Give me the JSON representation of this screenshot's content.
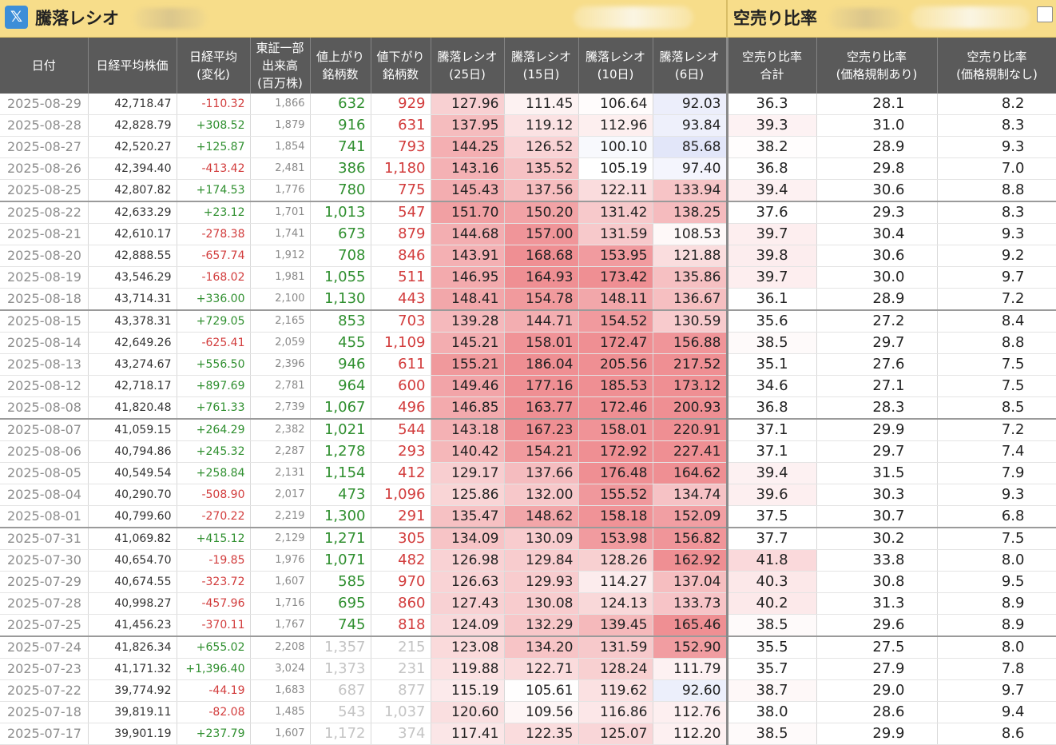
{
  "header": {
    "app_icon": "x-logo-icon",
    "app_icon_glyph": "𝕏",
    "left_title": "騰落レシオ",
    "right_title": "空売り比率"
  },
  "columns": [
    "日付",
    "日経平均株価",
    "日経平均\n(変化)",
    "東証一部\n出来高\n(百万株)",
    "値上がり\n銘柄数",
    "値下がり\n銘柄数",
    "騰落レシオ\n(25日)",
    "騰落レシオ\n(15日)",
    "騰落レシオ\n(10日)",
    "騰落レシオ\n(6日)",
    "空売り比率\n合計",
    "空売り比率\n(価格規制あり)",
    "空売り比率\n(価格規制なし)"
  ],
  "colors": {
    "header_bg": "#5a5a5a",
    "title_bar": "#f7dd8a",
    "positive": "#2f8f2f",
    "negative": "#d23c3c",
    "heat_high": "#ef8f93",
    "heat_low": "#e3e6f7"
  },
  "rows": [
    {
      "date": "2025-08-29",
      "nikkei": "42,718.47",
      "change": "-110.32",
      "volume": "1,866",
      "adv": "632",
      "dec": "929",
      "r25": "127.96",
      "r15": "111.45",
      "r10": "106.64",
      "r6": "92.03",
      "sr_total": "36.3",
      "sr_reg": "28.1",
      "sr_noreg": "8.2"
    },
    {
      "date": "2025-08-28",
      "nikkei": "42,828.79",
      "change": "+308.52",
      "volume": "1,879",
      "adv": "916",
      "dec": "631",
      "r25": "137.95",
      "r15": "119.12",
      "r10": "112.96",
      "r6": "93.84",
      "sr_total": "39.3",
      "sr_reg": "31.0",
      "sr_noreg": "8.3"
    },
    {
      "date": "2025-08-27",
      "nikkei": "42,520.27",
      "change": "+125.87",
      "volume": "1,854",
      "adv": "741",
      "dec": "793",
      "r25": "144.25",
      "r15": "126.52",
      "r10": "100.10",
      "r6": "85.68",
      "sr_total": "38.2",
      "sr_reg": "28.9",
      "sr_noreg": "9.3"
    },
    {
      "date": "2025-08-26",
      "nikkei": "42,394.40",
      "change": "-413.42",
      "volume": "2,481",
      "adv": "386",
      "dec": "1,180",
      "r25": "143.16",
      "r15": "135.52",
      "r10": "105.19",
      "r6": "97.40",
      "sr_total": "36.8",
      "sr_reg": "29.8",
      "sr_noreg": "7.0"
    },
    {
      "date": "2025-08-25",
      "nikkei": "42,807.82",
      "change": "+174.53",
      "volume": "1,776",
      "adv": "780",
      "dec": "775",
      "r25": "145.43",
      "r15": "137.56",
      "r10": "122.11",
      "r6": "133.94",
      "sr_total": "39.4",
      "sr_reg": "30.6",
      "sr_noreg": "8.8"
    },
    {
      "date": "2025-08-22",
      "nikkei": "42,633.29",
      "change": "+23.12",
      "volume": "1,701",
      "adv": "1,013",
      "dec": "547",
      "r25": "151.70",
      "r15": "150.20",
      "r10": "131.42",
      "r6": "138.25",
      "sr_total": "37.6",
      "sr_reg": "29.3",
      "sr_noreg": "8.3",
      "wk": true
    },
    {
      "date": "2025-08-21",
      "nikkei": "42,610.17",
      "change": "-278.38",
      "volume": "1,741",
      "adv": "673",
      "dec": "879",
      "r25": "144.68",
      "r15": "157.00",
      "r10": "131.59",
      "r6": "108.53",
      "sr_total": "39.7",
      "sr_reg": "30.4",
      "sr_noreg": "9.3"
    },
    {
      "date": "2025-08-20",
      "nikkei": "42,888.55",
      "change": "-657.74",
      "volume": "1,912",
      "adv": "708",
      "dec": "846",
      "r25": "143.91",
      "r15": "168.68",
      "r10": "153.95",
      "r6": "121.88",
      "sr_total": "39.8",
      "sr_reg": "30.6",
      "sr_noreg": "9.2"
    },
    {
      "date": "2025-08-19",
      "nikkei": "43,546.29",
      "change": "-168.02",
      "volume": "1,981",
      "adv": "1,055",
      "dec": "511",
      "r25": "146.95",
      "r15": "164.93",
      "r10": "173.42",
      "r6": "135.86",
      "sr_total": "39.7",
      "sr_reg": "30.0",
      "sr_noreg": "9.7"
    },
    {
      "date": "2025-08-18",
      "nikkei": "43,714.31",
      "change": "+336.00",
      "volume": "2,100",
      "adv": "1,130",
      "dec": "443",
      "r25": "148.41",
      "r15": "154.78",
      "r10": "148.11",
      "r6": "136.67",
      "sr_total": "36.1",
      "sr_reg": "28.9",
      "sr_noreg": "7.2"
    },
    {
      "date": "2025-08-15",
      "nikkei": "43,378.31",
      "change": "+729.05",
      "volume": "2,165",
      "adv": "853",
      "dec": "703",
      "r25": "139.28",
      "r15": "144.71",
      "r10": "154.52",
      "r6": "130.59",
      "sr_total": "35.6",
      "sr_reg": "27.2",
      "sr_noreg": "8.4",
      "wk": true
    },
    {
      "date": "2025-08-14",
      "nikkei": "42,649.26",
      "change": "-625.41",
      "volume": "2,059",
      "adv": "455",
      "dec": "1,109",
      "r25": "145.21",
      "r15": "158.01",
      "r10": "172.47",
      "r6": "156.88",
      "sr_total": "38.5",
      "sr_reg": "29.7",
      "sr_noreg": "8.8"
    },
    {
      "date": "2025-08-13",
      "nikkei": "43,274.67",
      "change": "+556.50",
      "volume": "2,396",
      "adv": "946",
      "dec": "611",
      "r25": "155.21",
      "r15": "186.04",
      "r10": "205.56",
      "r6": "217.52",
      "sr_total": "35.1",
      "sr_reg": "27.6",
      "sr_noreg": "7.5"
    },
    {
      "date": "2025-08-12",
      "nikkei": "42,718.17",
      "change": "+897.69",
      "volume": "2,781",
      "adv": "964",
      "dec": "600",
      "r25": "149.46",
      "r15": "177.16",
      "r10": "185.53",
      "r6": "173.12",
      "sr_total": "34.6",
      "sr_reg": "27.1",
      "sr_noreg": "7.5"
    },
    {
      "date": "2025-08-08",
      "nikkei": "41,820.48",
      "change": "+761.33",
      "volume": "2,739",
      "adv": "1,067",
      "dec": "496",
      "r25": "146.85",
      "r15": "163.77",
      "r10": "172.46",
      "r6": "200.93",
      "sr_total": "36.8",
      "sr_reg": "28.3",
      "sr_noreg": "8.5"
    },
    {
      "date": "2025-08-07",
      "nikkei": "41,059.15",
      "change": "+264.29",
      "volume": "2,382",
      "adv": "1,021",
      "dec": "544",
      "r25": "143.18",
      "r15": "167.23",
      "r10": "158.01",
      "r6": "220.91",
      "sr_total": "37.1",
      "sr_reg": "29.9",
      "sr_noreg": "7.2",
      "wk": true
    },
    {
      "date": "2025-08-06",
      "nikkei": "40,794.86",
      "change": "+245.32",
      "volume": "2,287",
      "adv": "1,278",
      "dec": "293",
      "r25": "140.42",
      "r15": "154.21",
      "r10": "172.92",
      "r6": "227.41",
      "sr_total": "37.1",
      "sr_reg": "29.7",
      "sr_noreg": "7.4"
    },
    {
      "date": "2025-08-05",
      "nikkei": "40,549.54",
      "change": "+258.84",
      "volume": "2,131",
      "adv": "1,154",
      "dec": "412",
      "r25": "129.17",
      "r15": "137.66",
      "r10": "176.48",
      "r6": "164.62",
      "sr_total": "39.4",
      "sr_reg": "31.5",
      "sr_noreg": "7.9"
    },
    {
      "date": "2025-08-04",
      "nikkei": "40,290.70",
      "change": "-508.90",
      "volume": "2,017",
      "adv": "473",
      "dec": "1,096",
      "r25": "125.86",
      "r15": "132.00",
      "r10": "155.52",
      "r6": "134.74",
      "sr_total": "39.6",
      "sr_reg": "30.3",
      "sr_noreg": "9.3"
    },
    {
      "date": "2025-08-01",
      "nikkei": "40,799.60",
      "change": "-270.22",
      "volume": "2,219",
      "adv": "1,300",
      "dec": "291",
      "r25": "135.47",
      "r15": "148.62",
      "r10": "158.18",
      "r6": "152.09",
      "sr_total": "37.5",
      "sr_reg": "30.7",
      "sr_noreg": "6.8"
    },
    {
      "date": "2025-07-31",
      "nikkei": "41,069.82",
      "change": "+415.12",
      "volume": "2,129",
      "adv": "1,271",
      "dec": "305",
      "r25": "134.09",
      "r15": "130.09",
      "r10": "153.98",
      "r6": "156.82",
      "sr_total": "37.7",
      "sr_reg": "30.2",
      "sr_noreg": "7.5",
      "wk": true
    },
    {
      "date": "2025-07-30",
      "nikkei": "40,654.70",
      "change": "-19.85",
      "volume": "1,976",
      "adv": "1,071",
      "dec": "482",
      "r25": "126.98",
      "r15": "129.84",
      "r10": "128.26",
      "r6": "162.92",
      "sr_total": "41.8",
      "sr_reg": "33.8",
      "sr_noreg": "8.0"
    },
    {
      "date": "2025-07-29",
      "nikkei": "40,674.55",
      "change": "-323.72",
      "volume": "1,607",
      "adv": "585",
      "dec": "970",
      "r25": "126.63",
      "r15": "129.93",
      "r10": "114.27",
      "r6": "137.04",
      "sr_total": "40.3",
      "sr_reg": "30.8",
      "sr_noreg": "9.5"
    },
    {
      "date": "2025-07-28",
      "nikkei": "40,998.27",
      "change": "-457.96",
      "volume": "1,716",
      "adv": "695",
      "dec": "860",
      "r25": "127.43",
      "r15": "130.08",
      "r10": "124.13",
      "r6": "133.73",
      "sr_total": "40.2",
      "sr_reg": "31.3",
      "sr_noreg": "8.9"
    },
    {
      "date": "2025-07-25",
      "nikkei": "41,456.23",
      "change": "-370.11",
      "volume": "1,767",
      "adv": "745",
      "dec": "818",
      "r25": "124.09",
      "r15": "132.29",
      "r10": "139.45",
      "r6": "165.46",
      "sr_total": "38.5",
      "sr_reg": "29.6",
      "sr_noreg": "8.9"
    },
    {
      "date": "2025-07-24",
      "nikkei": "41,826.34",
      "change": "+655.02",
      "volume": "2,208",
      "adv": "1,357",
      "dec": "215",
      "r25": "123.08",
      "r15": "134.20",
      "r10": "131.59",
      "r6": "152.90",
      "sr_total": "35.5",
      "sr_reg": "27.5",
      "sr_noreg": "8.0",
      "wk": true,
      "dim": true
    },
    {
      "date": "2025-07-23",
      "nikkei": "41,171.32",
      "change": "+1,396.40",
      "volume": "3,024",
      "adv": "1,373",
      "dec": "231",
      "r25": "119.88",
      "r15": "122.71",
      "r10": "128.24",
      "r6": "111.79",
      "sr_total": "35.7",
      "sr_reg": "27.9",
      "sr_noreg": "7.8",
      "dim": true
    },
    {
      "date": "2025-07-22",
      "nikkei": "39,774.92",
      "change": "-44.19",
      "volume": "1,683",
      "adv": "687",
      "dec": "877",
      "r25": "115.19",
      "r15": "105.61",
      "r10": "119.62",
      "r6": "92.60",
      "sr_total": "38.7",
      "sr_reg": "29.0",
      "sr_noreg": "9.7",
      "dim": true
    },
    {
      "date": "2025-07-18",
      "nikkei": "39,819.11",
      "change": "-82.08",
      "volume": "1,485",
      "adv": "543",
      "dec": "1,037",
      "r25": "120.60",
      "r15": "109.56",
      "r10": "116.86",
      "r6": "112.76",
      "sr_total": "38.0",
      "sr_reg": "28.6",
      "sr_noreg": "9.4",
      "dim": true
    },
    {
      "date": "2025-07-17",
      "nikkei": "39,901.19",
      "change": "+237.79",
      "volume": "1,607",
      "adv": "1,172",
      "dec": "374",
      "r25": "117.41",
      "r15": "122.35",
      "r10": "125.07",
      "r6": "112.20",
      "sr_total": "38.5",
      "sr_reg": "29.9",
      "sr_noreg": "8.6",
      "dim": true
    }
  ]
}
